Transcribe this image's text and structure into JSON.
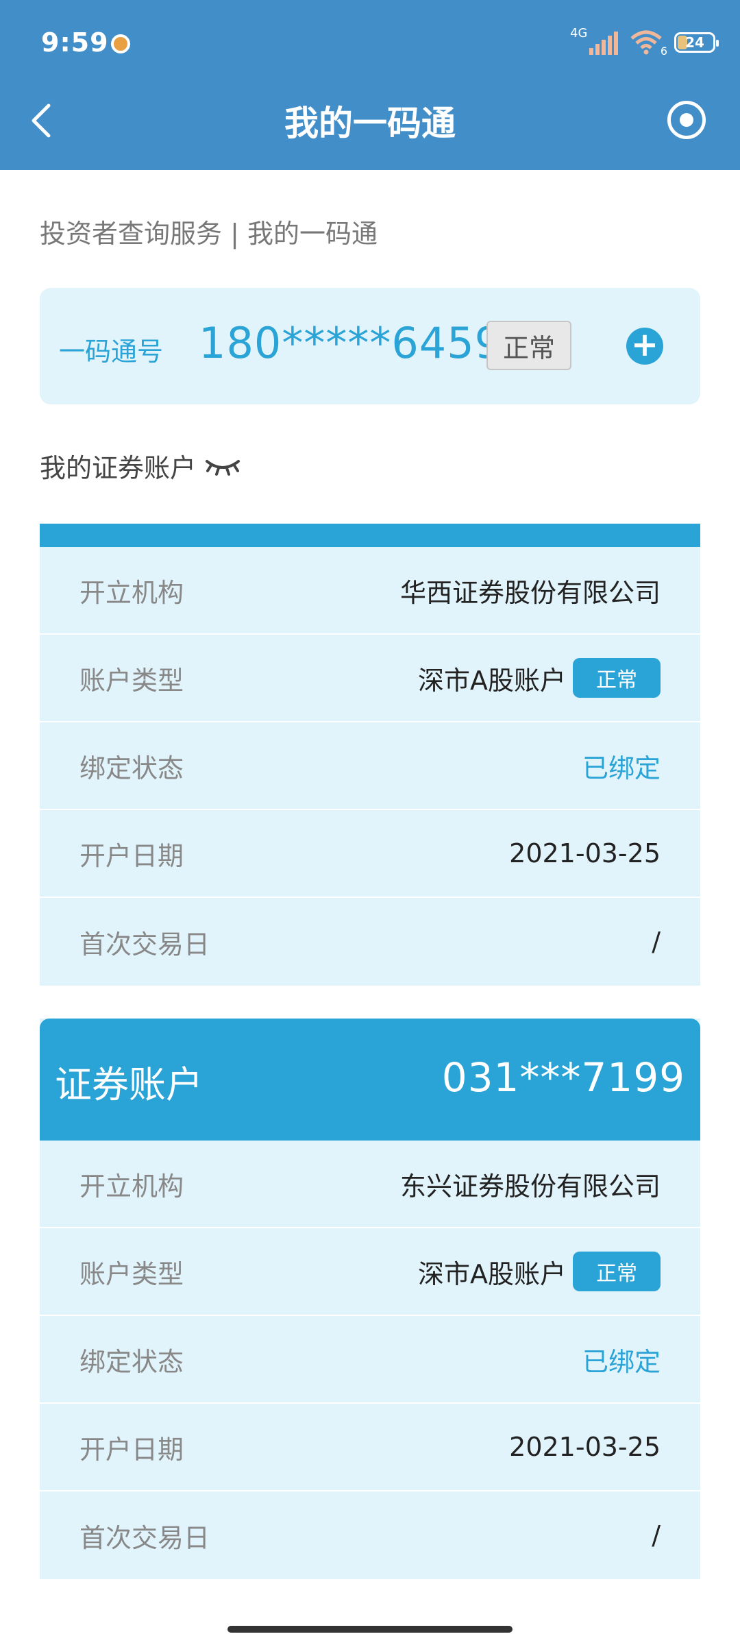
{
  "status_bar": {
    "time": "9:59",
    "network": "4G",
    "wifi_label": "6",
    "battery": "24"
  },
  "header": {
    "title": "我的一码通"
  },
  "breadcrumb": "投资者查询服务 | 我的一码通",
  "code_card": {
    "label": "一码通号",
    "value": "180*****6459",
    "status": "正常"
  },
  "section_title": "我的证券账户",
  "accounts": [
    {
      "head_title": "",
      "head_number": "",
      "rows": [
        {
          "label": "开立机构",
          "value": "华西证券股份有限公司"
        },
        {
          "label": "账户类型",
          "value": "深市A股账户",
          "badge": "正常"
        },
        {
          "label": "绑定状态",
          "value": "已绑定"
        },
        {
          "label": "开户日期",
          "value": "2021-03-25"
        },
        {
          "label": "首次交易日",
          "value": "/"
        }
      ]
    },
    {
      "head_title": "证券账户",
      "head_number": "031***7199",
      "rows": [
        {
          "label": "开立机构",
          "value": "东兴证券股份有限公司"
        },
        {
          "label": "账户类型",
          "value": "深市A股账户",
          "badge": "正常"
        },
        {
          "label": "绑定状态",
          "value": "已绑定"
        },
        {
          "label": "开户日期",
          "value": "2021-03-25"
        },
        {
          "label": "首次交易日",
          "value": "/"
        }
      ]
    }
  ],
  "colors": {
    "header_bg": "#428ec8",
    "accent": "#2aa3d6",
    "card_bg": "#e2f4fb"
  }
}
